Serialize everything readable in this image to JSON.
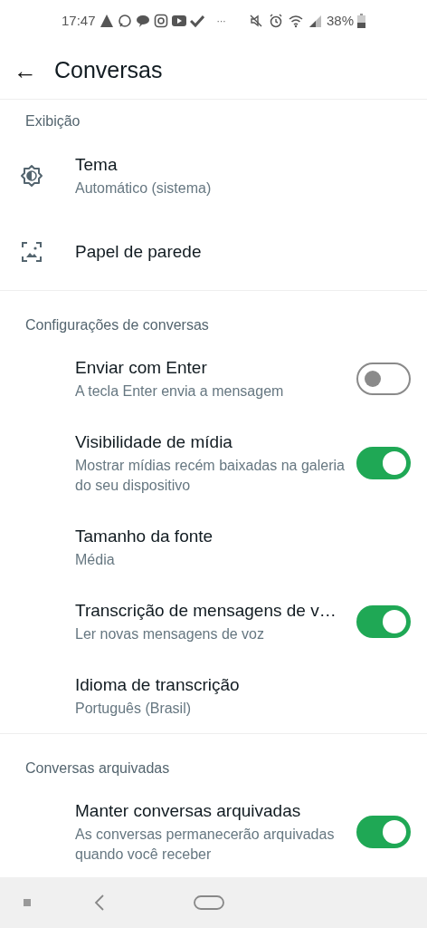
{
  "status_bar": {
    "time": "17:47",
    "overflow": "···",
    "battery": "38%"
  },
  "header": {
    "back": "←",
    "title": "Conversas"
  },
  "sections": [
    {
      "title": "Exibição",
      "items": [
        {
          "kind": "link",
          "title": "Tema",
          "subtitle": "Automático (sistema)"
        },
        {
          "kind": "link",
          "title": "Papel de parede"
        }
      ]
    },
    {
      "title": "Configurações de conversas",
      "items": [
        {
          "kind": "toggle",
          "title": "Enviar com Enter",
          "subtitle": "A tecla Enter envia a mensagem",
          "on": false
        },
        {
          "kind": "toggle",
          "title": "Visibilidade de mídia",
          "subtitle": "Mostrar mídias recém baixadas na galeria do seu dispositivo",
          "on": true
        },
        {
          "kind": "link",
          "title": "Tamanho da fonte",
          "subtitle": "Média"
        },
        {
          "kind": "toggle",
          "title": "Transcrição de mensagens de v…",
          "subtitle": "Ler novas mensagens de voz",
          "on": true
        },
        {
          "kind": "link",
          "title": "Idioma de transcrição",
          "subtitle": "Português (Brasil)"
        }
      ]
    },
    {
      "title": "Conversas arquivadas",
      "items": [
        {
          "kind": "toggle",
          "title": "Manter conversas arquivadas",
          "subtitle": "As conversas permanecerão arquivadas quando você receber",
          "on": true
        }
      ]
    }
  ]
}
